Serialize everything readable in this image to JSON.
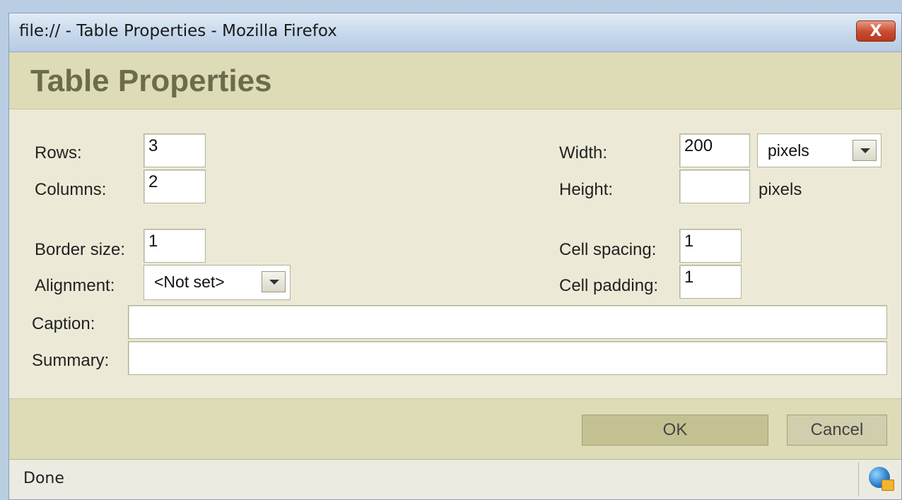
{
  "window": {
    "title": "file:// - Table Properties - Mozilla Firefox",
    "close_label": "X"
  },
  "dialog": {
    "title": "Table Properties"
  },
  "fields": {
    "rows": {
      "label": "Rows:",
      "value": "3"
    },
    "columns": {
      "label": "Columns:",
      "value": "2"
    },
    "border_size": {
      "label": "Border size:",
      "value": "1"
    },
    "alignment": {
      "label": "Alignment:",
      "value": "<Not set>"
    },
    "caption": {
      "label": "Caption:",
      "value": ""
    },
    "summary": {
      "label": "Summary:",
      "value": ""
    },
    "width": {
      "label": "Width:",
      "value": "200",
      "unit_selected": "pixels"
    },
    "height": {
      "label": "Height:",
      "value": "",
      "unit": "pixels"
    },
    "cell_spacing": {
      "label": "Cell spacing:",
      "value": "1"
    },
    "cell_padding": {
      "label": "Cell padding:",
      "value": "1"
    }
  },
  "buttons": {
    "ok": "OK",
    "cancel": "Cancel"
  },
  "status": {
    "text": "Done"
  },
  "icons": {
    "status_icon": "globe-icon"
  },
  "colors": {
    "title_text": "#6b6c4c",
    "band": "#dedcb7",
    "panel": "#ecead7",
    "ok_button": "#c3c191"
  }
}
